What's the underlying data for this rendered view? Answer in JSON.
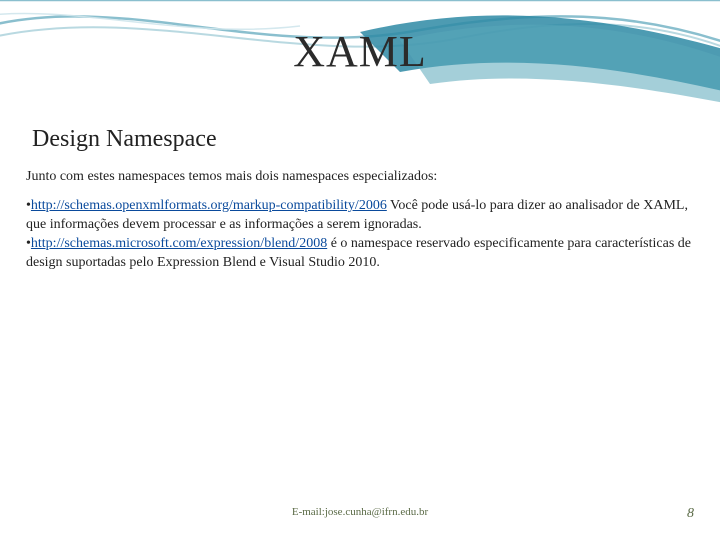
{
  "title": "XAML",
  "section_heading": "Design Namespace",
  "intro": "Junto com estes namespaces temos mais dois namespaces especializados:",
  "bullets": {
    "b1_prefix": "•",
    "b1_link": "http://schemas.openxmlformats.org/markup-compatibility/2006",
    "b1_tail": " Você pode usá-lo para dizer ao analisador de XAML, que informações devem processar e as informações a serem ignoradas.",
    "b2_prefix": "•",
    "b2_link": "http://schemas.microsoft.com/expression/blend/2008",
    "b2_tail": " é o namespace reservado especificamente para características de design suportadas pelo Expression Blend e Visual Studio 2010."
  },
  "footer": {
    "email": "E-mail:jose.cunha@ifrn.edu.br",
    "page": "8"
  }
}
